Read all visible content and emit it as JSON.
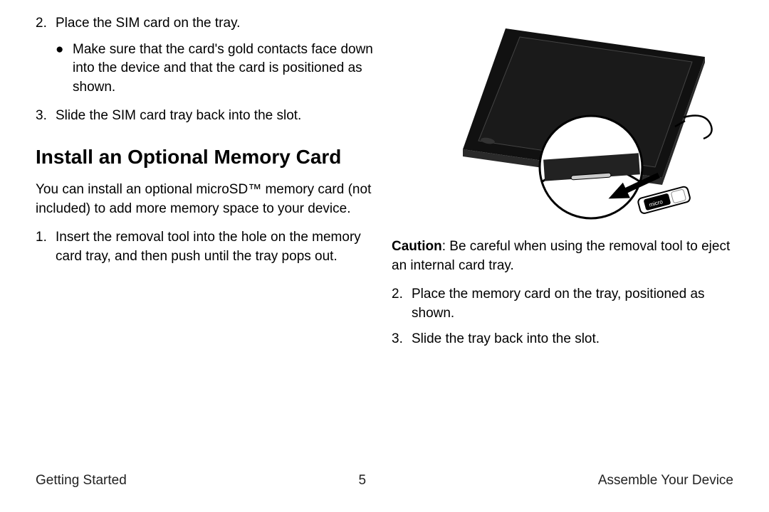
{
  "left": {
    "step2_num": "2.",
    "step2_text": "Place the SIM card on the tray.",
    "step2_bullet": "Make sure that the card's gold contacts face down into the device and that the card is positioned as shown.",
    "step3_num": "3.",
    "step3_text": "Slide the SIM card tray back into the slot.",
    "heading": "Install an Optional Memory Card",
    "intro": "You can install an optional microSD™ memory card (not included) to add more memory space to your device.",
    "m_step1_num": "1.",
    "m_step1_text": "Insert the removal tool into the hole on the memory card tray, and then push until the tray pops out."
  },
  "right": {
    "caution_label": "Caution",
    "caution_text": ": Be careful when using the removal tool to eject an internal card tray.",
    "r_step2_num": "2.",
    "r_step2_text": "Place the memory card on the tray, positioned as shown.",
    "r_step3_num": "3.",
    "r_step3_text": "Slide the tray back into the slot."
  },
  "footer": {
    "left": "Getting Started",
    "page": "5",
    "right": "Assemble Your Device"
  },
  "illustration_alt": "Tablet with memory card tray being inserted"
}
